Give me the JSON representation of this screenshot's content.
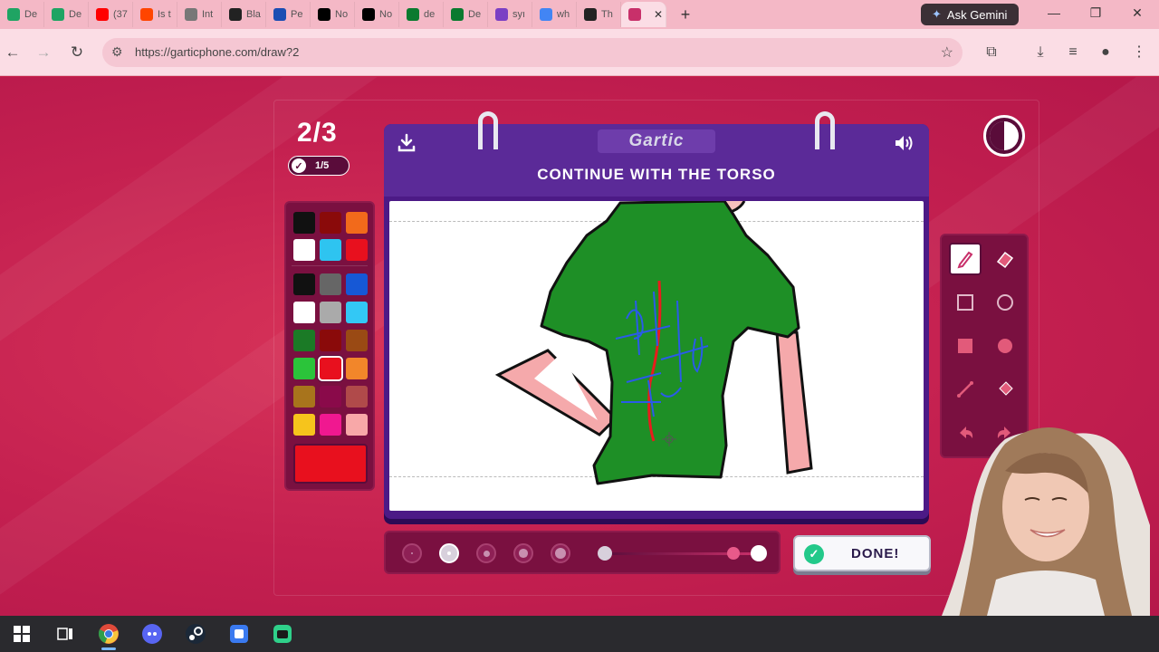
{
  "browser": {
    "tabs": [
      {
        "label": "De",
        "icon": "google-drive-icon",
        "color": "#1fa463"
      },
      {
        "label": "De",
        "icon": "google-drive-icon",
        "color": "#1fa463"
      },
      {
        "label": "(37",
        "icon": "youtube-icon",
        "color": "#ff0000"
      },
      {
        "label": "Is t",
        "icon": "reddit-icon",
        "color": "#ff4500"
      },
      {
        "label": "Int",
        "icon": "globe-icon",
        "color": "#777777"
      },
      {
        "label": "Bla",
        "icon": "wix-icon",
        "color": "#222222"
      },
      {
        "label": "Pe",
        "icon": "site-icon",
        "color": "#1a4db3"
      },
      {
        "label": "No",
        "icon": "x-icon",
        "color": "#000000"
      },
      {
        "label": "No",
        "icon": "x-icon",
        "color": "#000000"
      },
      {
        "label": "de",
        "icon": "site-icon",
        "color": "#0a7a2f"
      },
      {
        "label": "De",
        "icon": "site-icon",
        "color": "#0a7a2f"
      },
      {
        "label": "syı",
        "icon": "peace-icon",
        "color": "#7b3fc4"
      },
      {
        "label": "wh",
        "icon": "google-icon",
        "color": "#4285f4"
      },
      {
        "label": "Th",
        "icon": "site-icon",
        "color": "#222222"
      },
      {
        "label": "",
        "icon": "garticphone-icon",
        "color": "#c8306a"
      }
    ],
    "ask_gemini": "Ask Gemini",
    "url": "https://garticphone.com/draw?2"
  },
  "game": {
    "round": "2/3",
    "done_count": "1/5",
    "logo": "Gartic",
    "instruction": "CONTINUE WITH THE TORSO",
    "done_label": "DONE!",
    "selected_color": "#e8101e",
    "palette_top": [
      "#111111",
      "#8a0a0a",
      "#f26a1b",
      "#ffffff",
      "#2ec4f0",
      "#e8101e"
    ],
    "palette": [
      "#111111",
      "#666666",
      "#1658d6",
      "#ffffff",
      "#aaaaaa",
      "#33c8f5",
      "#1b7a26",
      "#8a0a0a",
      "#9a4a14",
      "#2bc43a",
      "#e8101e",
      "#f2862a",
      "#a8741c",
      "#8a0a4a",
      "#b04a4a",
      "#f6c41c",
      "#f01890",
      "#f8a8a8"
    ],
    "tools": [
      "pencil-icon",
      "eraser-icon",
      "rect-outline-icon",
      "ellipse-outline-icon",
      "rect-filled-icon",
      "ellipse-filled-icon",
      "line-icon",
      "fill-bucket-icon",
      "undo-icon",
      "redo-icon"
    ],
    "brush_sizes": 5,
    "selected_brush_index": 1
  },
  "taskbar": {
    "icons": [
      "windows-start-icon",
      "task-view-icon",
      "chrome-icon",
      "discord-icon",
      "steam-icon",
      "app-icon",
      "app-icon-2"
    ]
  }
}
